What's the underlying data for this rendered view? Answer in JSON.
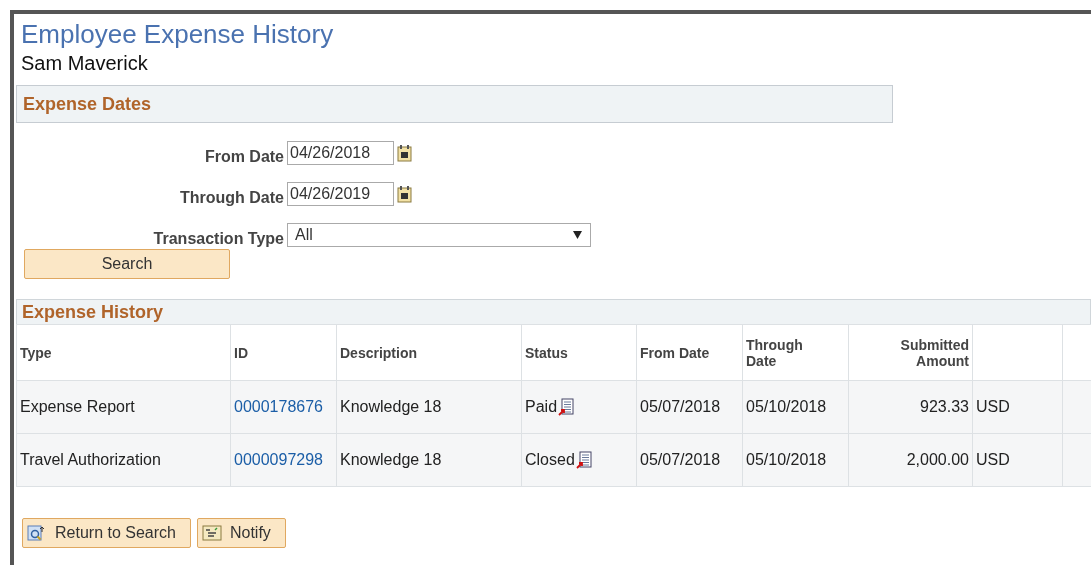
{
  "title": "Employee Expense History",
  "employee": "Sam Maverick",
  "expense_dates": {
    "title": "Expense Dates",
    "fields": [
      {
        "kind": "date",
        "label": "From Date",
        "value": "04/26/2018"
      },
      {
        "kind": "date",
        "label": "Through Date",
        "value": "04/26/2019"
      },
      {
        "kind": "select",
        "label": "Transaction Type",
        "value": "All"
      }
    ],
    "search_button": "Search"
  },
  "expense_history": {
    "title": "Expense History",
    "columns": [
      "Type",
      "ID",
      "Description",
      "Status",
      "From Date",
      "Through Date",
      "Submitted Amount"
    ],
    "rows": [
      {
        "type": "Expense Report",
        "id": "0000178676",
        "description": "Knowledge 18",
        "status": "Paid",
        "from_date": "05/07/2018",
        "through_date": "05/10/2018",
        "amount": "923.33",
        "currency": "USD"
      },
      {
        "type": "Travel Authorization",
        "id": "0000097298",
        "description": "Knowledge 18",
        "status": "Closed",
        "from_date": "05/07/2018",
        "through_date": "05/10/2018",
        "amount": "2,000.00",
        "currency": "USD"
      }
    ]
  },
  "buttons": [
    {
      "kind": "return",
      "label": "Return to Search"
    },
    {
      "kind": "notify",
      "label": "Notify"
    }
  ]
}
